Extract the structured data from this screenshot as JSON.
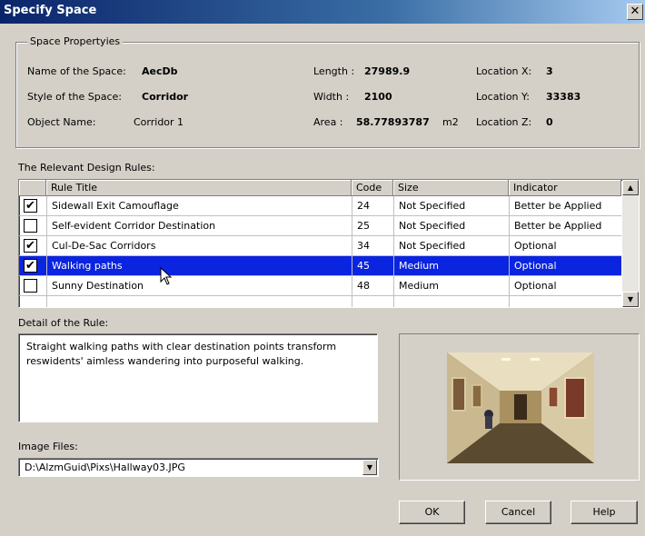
{
  "window": {
    "title": "Specify Space",
    "close_glyph": "✕"
  },
  "space_properties": {
    "legend": "Space Propertyies",
    "name_label": "Name of the Space:",
    "name_value": "AecDb",
    "style_label": "Style of the Space:",
    "style_value": "Corridor",
    "object_label": "Object Name:",
    "object_value": "Corridor 1",
    "length_label": "Length :",
    "length_value": "27989.9",
    "width_label": "Width :",
    "width_value": "2100",
    "area_label": "Area :",
    "area_value": "58.77893787",
    "area_unit": "m2",
    "locx_label": "Location X:",
    "locx_value": "3",
    "locy_label": "Location Y:",
    "locy_value": "33383",
    "locz_label": "Location Z:",
    "locz_value": "0"
  },
  "rules": {
    "label": "The Relevant Design Rules:",
    "columns": {
      "rule_title": "Rule Title",
      "code": "Code",
      "size": "Size",
      "indicator": "Indicator"
    },
    "rows": [
      {
        "title": "Sidewall Exit Camouflage",
        "code": "24",
        "size": "Not Specified",
        "indicator": "Better be Applied",
        "checked": true,
        "check_glyph": "✔"
      },
      {
        "title": "Self-evident Corridor Destination",
        "code": "25",
        "size": "Not Specified",
        "indicator": "Better be Applied",
        "checked": false,
        "check_glyph": ""
      },
      {
        "title": "Cul-De-Sac Corridors",
        "code": "34",
        "size": "Not Specified",
        "indicator": "Optional",
        "checked": true,
        "check_glyph": "✔"
      },
      {
        "title": "Walking paths",
        "code": "45",
        "size": "Medium",
        "indicator": "Optional",
        "checked": true,
        "check_glyph": "✔",
        "selected": true
      },
      {
        "title": "Sunny Destination",
        "code": "48",
        "size": "Medium",
        "indicator": "Optional",
        "checked": false,
        "check_glyph": ""
      }
    ]
  },
  "detail": {
    "label": "Detail of the Rule:",
    "text": "Straight walking paths with clear destination points transform reswidents' aimless wandering into purposeful walking."
  },
  "image_files": {
    "label": "Image Files:",
    "value": "D:\\AlzmGuid\\Pixs\\Hallway03.JPG"
  },
  "buttons": {
    "ok": "OK",
    "cancel": "Cancel",
    "help": "Help"
  },
  "icons": {
    "scroll_up": "scroll-up-arrow-icon",
    "scroll_down": "scroll-down-arrow-icon",
    "dropdown": "dropdown-arrow-icon",
    "cursor": "mouse-pointer-icon"
  },
  "colors": {
    "title_start": "#0a246a",
    "title_end": "#a6caf0",
    "selection": "#0a24e0",
    "face": "#d4d0c8"
  }
}
